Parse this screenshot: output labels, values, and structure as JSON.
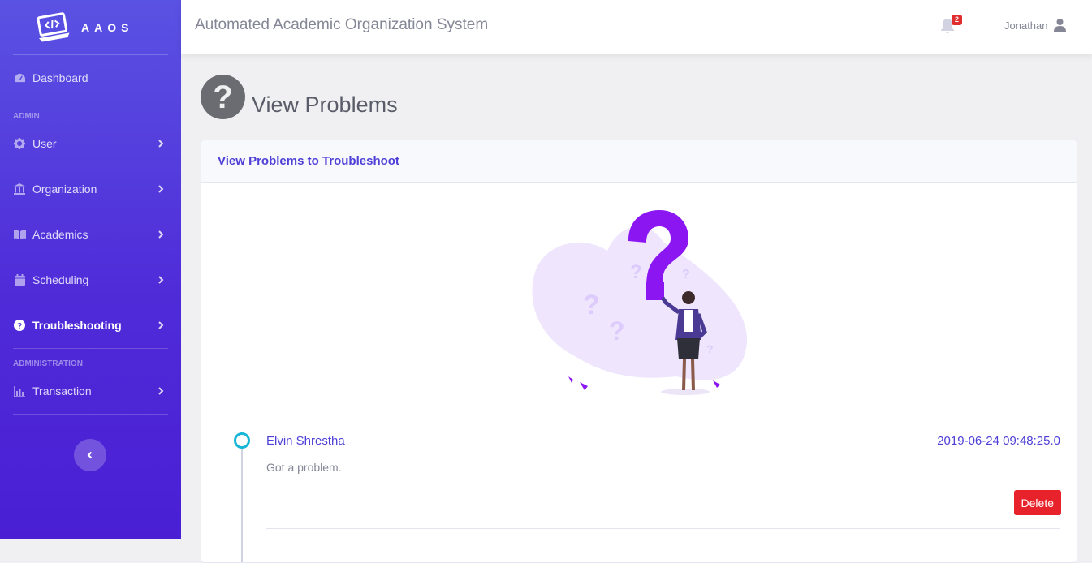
{
  "brand": {
    "name": "AAOS"
  },
  "sidebar": {
    "dashboard": {
      "label": "Dashboard",
      "icon": "tachometer-icon"
    },
    "sections": [
      {
        "heading": "ADMIN"
      },
      {
        "heading": "ADMINISTRATION"
      }
    ],
    "items": [
      {
        "label": "User",
        "icon": "gear-icon"
      },
      {
        "label": "Organization",
        "icon": "bank-icon"
      },
      {
        "label": "Academics",
        "icon": "book-icon"
      },
      {
        "label": "Scheduling",
        "icon": "calendar-icon"
      },
      {
        "label": "Troubleshooting",
        "icon": "question-circle-icon",
        "active": true
      },
      {
        "label": "Transaction",
        "icon": "chart-icon"
      }
    ]
  },
  "topbar": {
    "title": "Automated Academic Organization System",
    "notification_count": "2",
    "user_name": "Jonathan"
  },
  "page": {
    "title": "View Problems",
    "card_title": "View Problems to Troubleshoot"
  },
  "problems": [
    {
      "name": "Elvin Shrestha",
      "timestamp": "2019-06-24 09:48:25.0",
      "message": "Got a problem.",
      "delete_label": "Delete"
    }
  ],
  "colors": {
    "accent": "#4e3fd6",
    "sidebar_top": "#5a52e3",
    "sidebar_bottom": "#4a1fd4",
    "danger": "#e8222a",
    "timeline_dot": "#17b6d6",
    "illustration_purple": "#8b16f2"
  }
}
